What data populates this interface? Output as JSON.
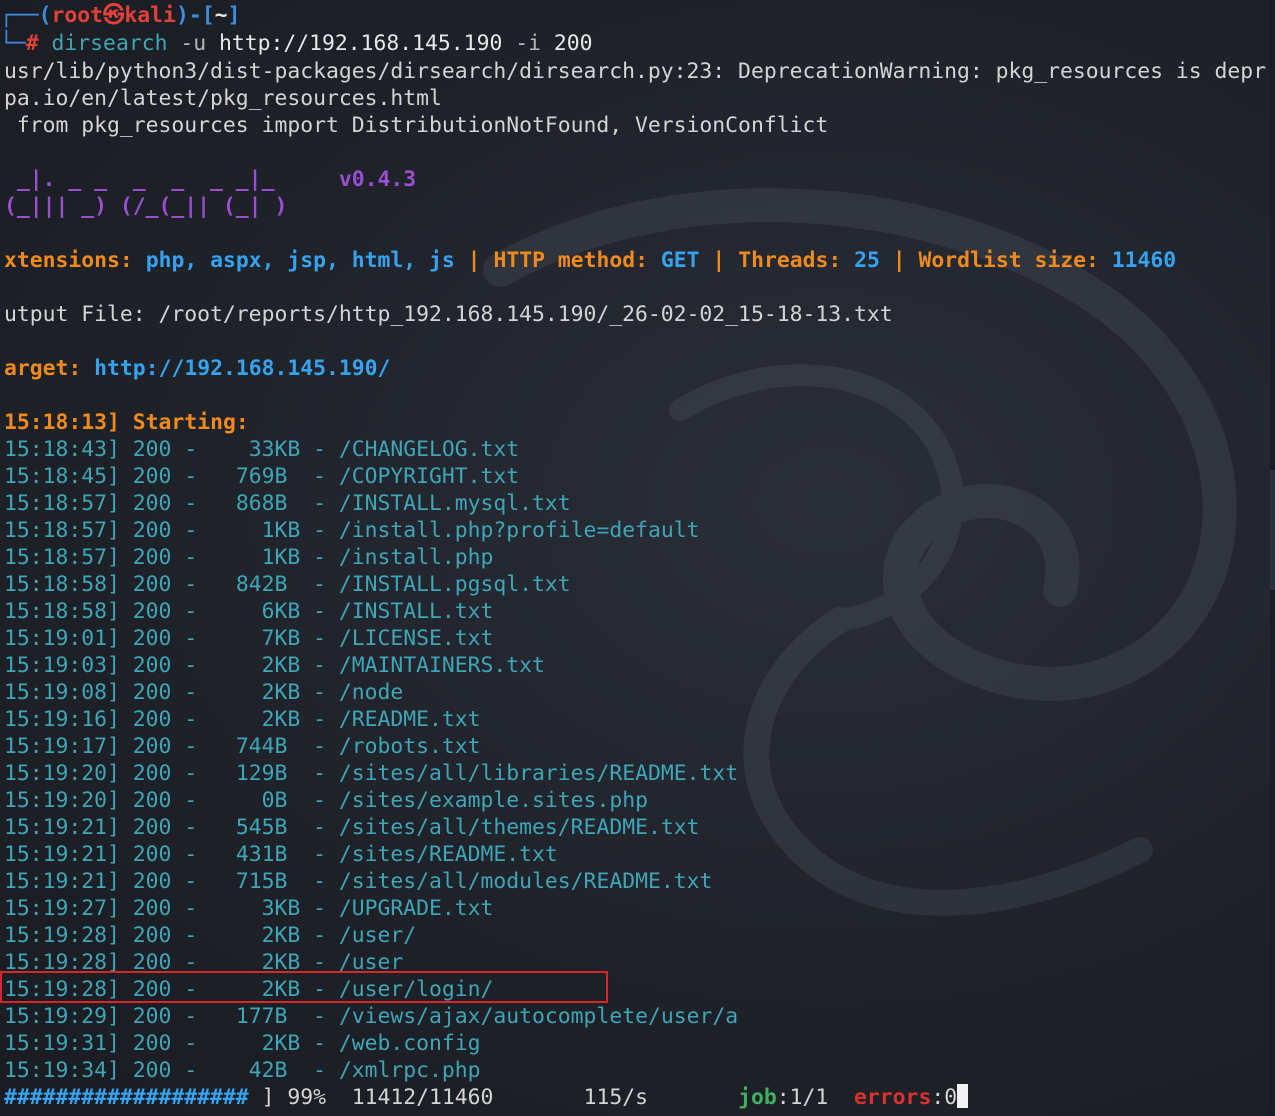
{
  "prompt": {
    "open": "┌──(",
    "user": "root㉿kali",
    "mid": ")-[",
    "dir": "~",
    "close": "]",
    "hash_prefix": "└─",
    "hash": "#",
    "command": "dirsearch",
    "args1": "-u",
    "url": "http://192.168.145.190",
    "args2": "-i",
    "code": "200"
  },
  "warning": {
    "line1": "usr/lib/python3/dist-packages/dirsearch/dirsearch.py:23: DeprecationWarning: pkg_resources is depr",
    "line2": "pa.io/en/latest/pkg_resources.html",
    "line3": " from pkg_resources import DistributionNotFound, VersionConflict"
  },
  "banner": {
    "art1": " _|. _ _  _  _  _ _|_",
    "art2": "(_||| _) (/_(_|| (_| )",
    "version": "v0.4.3"
  },
  "config": {
    "ext_label": "xtensions:",
    "ext_value": "php, aspx, jsp, html, js",
    "sep": "|",
    "method_label": "HTTP method:",
    "method_value": "GET",
    "threads_label": "Threads:",
    "threads_value": "25",
    "wordlist_label": "Wordlist size:",
    "wordlist_value": "11460"
  },
  "output": {
    "text": "utput File: /root/reports/http_192.168.145.190/_26-02-02_15-18-13.txt"
  },
  "target": {
    "label": "arget:",
    "url": "http://192.168.145.190/"
  },
  "starting": {
    "time": "15:18:13]",
    "label": "Starting:"
  },
  "results": [
    {
      "time": "15:18:43]",
      "code": "200",
      "size": "  33KB",
      "path": "/CHANGELOG.txt"
    },
    {
      "time": "15:18:45]",
      "code": "200",
      "size": " 769B ",
      "path": "/COPYRIGHT.txt"
    },
    {
      "time": "15:18:57]",
      "code": "200",
      "size": " 868B ",
      "path": "/INSTALL.mysql.txt"
    },
    {
      "time": "15:18:57]",
      "code": "200",
      "size": "   1KB",
      "path": "/install.php?profile=default"
    },
    {
      "time": "15:18:57]",
      "code": "200",
      "size": "   1KB",
      "path": "/install.php"
    },
    {
      "time": "15:18:58]",
      "code": "200",
      "size": " 842B ",
      "path": "/INSTALL.pgsql.txt"
    },
    {
      "time": "15:18:58]",
      "code": "200",
      "size": "   6KB",
      "path": "/INSTALL.txt"
    },
    {
      "time": "15:19:01]",
      "code": "200",
      "size": "   7KB",
      "path": "/LICENSE.txt"
    },
    {
      "time": "15:19:03]",
      "code": "200",
      "size": "   2KB",
      "path": "/MAINTAINERS.txt"
    },
    {
      "time": "15:19:08]",
      "code": "200",
      "size": "   2KB",
      "path": "/node"
    },
    {
      "time": "15:19:16]",
      "code": "200",
      "size": "   2KB",
      "path": "/README.txt"
    },
    {
      "time": "15:19:17]",
      "code": "200",
      "size": " 744B ",
      "path": "/robots.txt"
    },
    {
      "time": "15:19:20]",
      "code": "200",
      "size": " 129B ",
      "path": "/sites/all/libraries/README.txt"
    },
    {
      "time": "15:19:20]",
      "code": "200",
      "size": "   0B ",
      "path": "/sites/example.sites.php"
    },
    {
      "time": "15:19:21]",
      "code": "200",
      "size": " 545B ",
      "path": "/sites/all/themes/README.txt"
    },
    {
      "time": "15:19:21]",
      "code": "200",
      "size": " 431B ",
      "path": "/sites/README.txt"
    },
    {
      "time": "15:19:21]",
      "code": "200",
      "size": " 715B ",
      "path": "/sites/all/modules/README.txt"
    },
    {
      "time": "15:19:27]",
      "code": "200",
      "size": "   3KB",
      "path": "/UPGRADE.txt"
    },
    {
      "time": "15:19:28]",
      "code": "200",
      "size": "   2KB",
      "path": "/user/"
    },
    {
      "time": "15:19:28]",
      "code": "200",
      "size": "   2KB",
      "path": "/user"
    },
    {
      "time": "15:19:28]",
      "code": "200",
      "size": "   2KB",
      "path": "/user/login/"
    },
    {
      "time": "15:19:29]",
      "code": "200",
      "size": " 177B ",
      "path": "/views/ajax/autocomplete/user/a"
    },
    {
      "time": "15:19:31]",
      "code": "200",
      "size": "   2KB",
      "path": "/web.config"
    },
    {
      "time": "15:19:34]",
      "code": "200",
      "size": "  42B ",
      "path": "/xmlrpc.php"
    }
  ],
  "progress": {
    "bar": "###################",
    "close": " ] ",
    "percent": "99%",
    "count": "11412/11460",
    "rate": "115/s",
    "job_label": "job",
    "job_value": ":1/1",
    "errors_label": "errors",
    "errors_value": ":0"
  }
}
